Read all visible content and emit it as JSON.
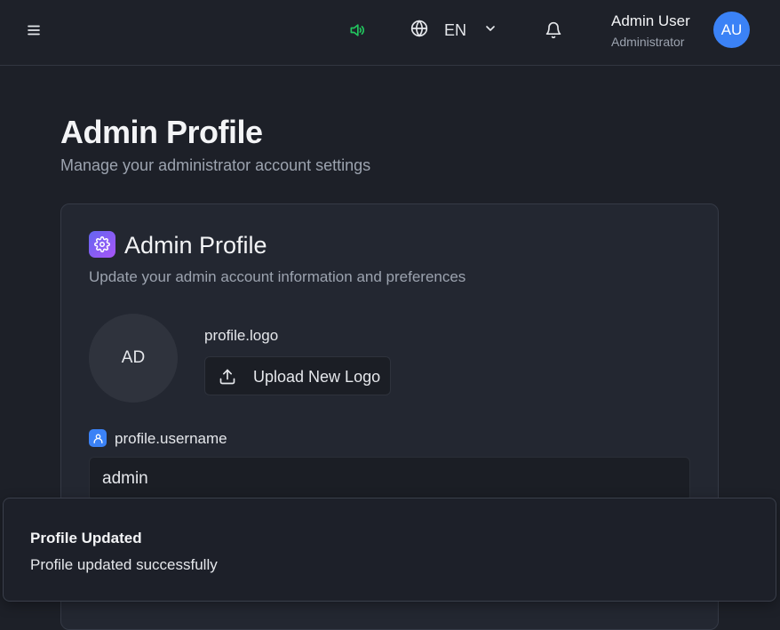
{
  "header": {
    "language": "EN",
    "user_name": "Admin User",
    "user_role": "Administrator",
    "avatar_initials": "AU",
    "icons": [
      "menu-icon",
      "speaker-icon",
      "globe-icon",
      "chevron-down-icon",
      "bell-icon"
    ],
    "speaker_color": "#22c55e",
    "avatar_color": "#3b82f6"
  },
  "page": {
    "title": "Admin Profile",
    "subtitle": "Manage your administrator account settings"
  },
  "card": {
    "title": "Admin Profile",
    "subtitle": "Update your admin account information and preferences",
    "logo_initials": "AD",
    "logo_label": "profile.logo",
    "upload_label": "Upload New Logo",
    "username_label": "profile.username",
    "username_value": "admin",
    "icon_gradient": [
      "#6366f1",
      "#a855f7"
    ]
  },
  "toast": {
    "title": "Profile Updated",
    "message": "Profile updated successfully"
  }
}
